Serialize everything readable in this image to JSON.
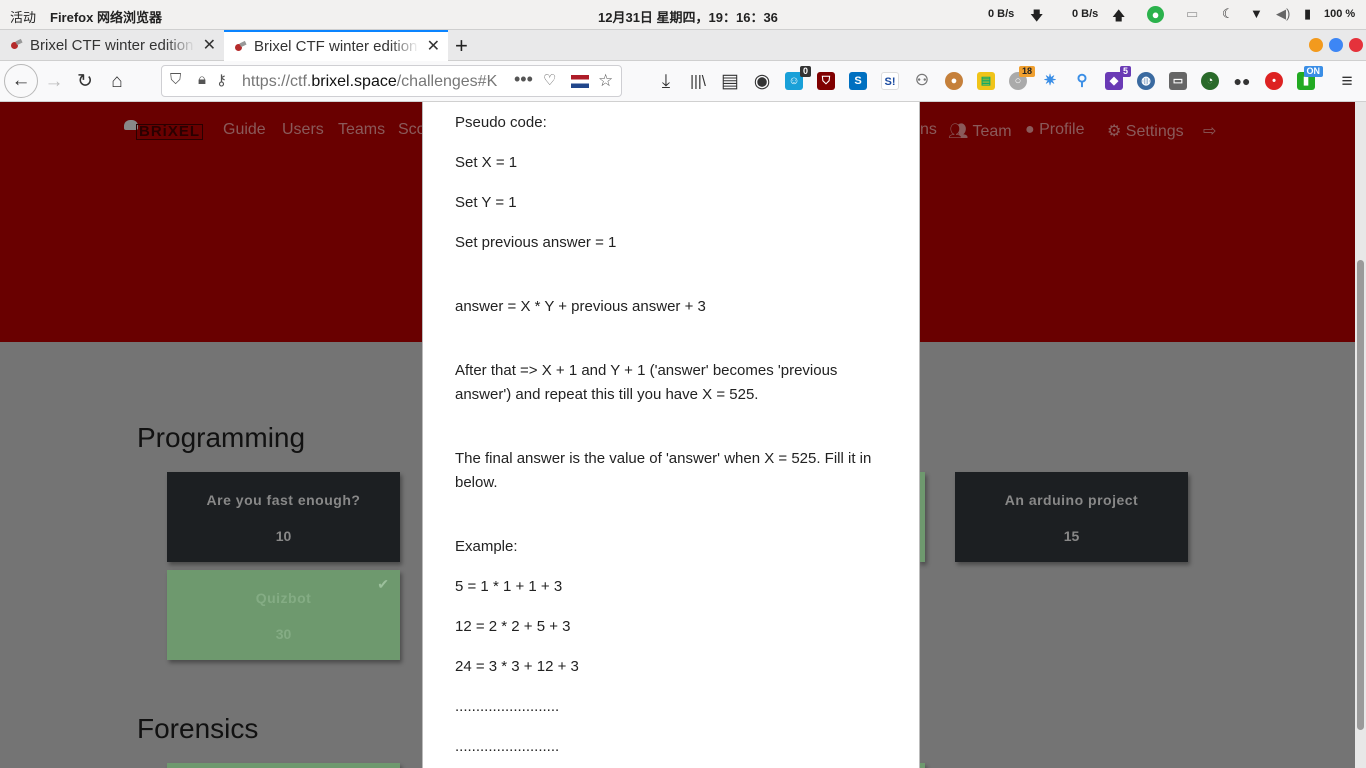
{
  "topbar": {
    "activities": "活动",
    "app_name": "Firefox 网络浏览器",
    "clock": "12月31日 星期四，19：16：36",
    "net_down": "0 B/s",
    "net_up": "0 B/s",
    "battery": "100 %"
  },
  "tabs": [
    {
      "title": "Brixel CTF winter edition"
    },
    {
      "title": "Brixel CTF winter edition"
    }
  ],
  "navbar": {
    "url_prefix": "https://ctf.",
    "url_domain": "brixel.space",
    "url_path": "/challenges#K",
    "ext_badges": {
      "a": "0",
      "b": "18",
      "c": "5",
      "d": "ON"
    }
  },
  "site_nav": {
    "guide": "Guide",
    "users": "Users",
    "teams": "Teams",
    "sco": "Sco",
    "ns": "ns",
    "team": "Team",
    "profile": "Profile",
    "settings": "Settings"
  },
  "categories": [
    {
      "name": "Programming"
    },
    {
      "name": "Forensics"
    }
  ],
  "cards": [
    {
      "name": "Are you fast enough?",
      "value": "10",
      "solved": false
    },
    {
      "name": "An arduino project",
      "value": "15",
      "solved": false
    },
    {
      "name": "Quizbot",
      "value": "30",
      "solved": true
    }
  ],
  "modal": {
    "lines": [
      "Pseudo code:",
      "Set X = 1",
      "Set Y = 1",
      "Set previous answer = 1",
      "answer = X * Y + previous answer + 3",
      "After that => X + 1 and Y + 1 ('answer' becomes 'previous answer') and repeat this till you have X = 525.",
      "The final answer is the value of 'answer' when X = 525. Fill it in below.",
      "Example:",
      "5 = 1 * 1 + 1 + 3",
      "12 = 2 * 2 + 5 + 3",
      "24 = 3 * 3 + 12 + 3",
      ".........................",
      "........................."
    ]
  },
  "colors": {
    "hero": "#690000",
    "backdrop": "#747474",
    "card": "#1c1f22",
    "card_solved": "#6e996e",
    "tab_accent": "#0a84ff"
  }
}
